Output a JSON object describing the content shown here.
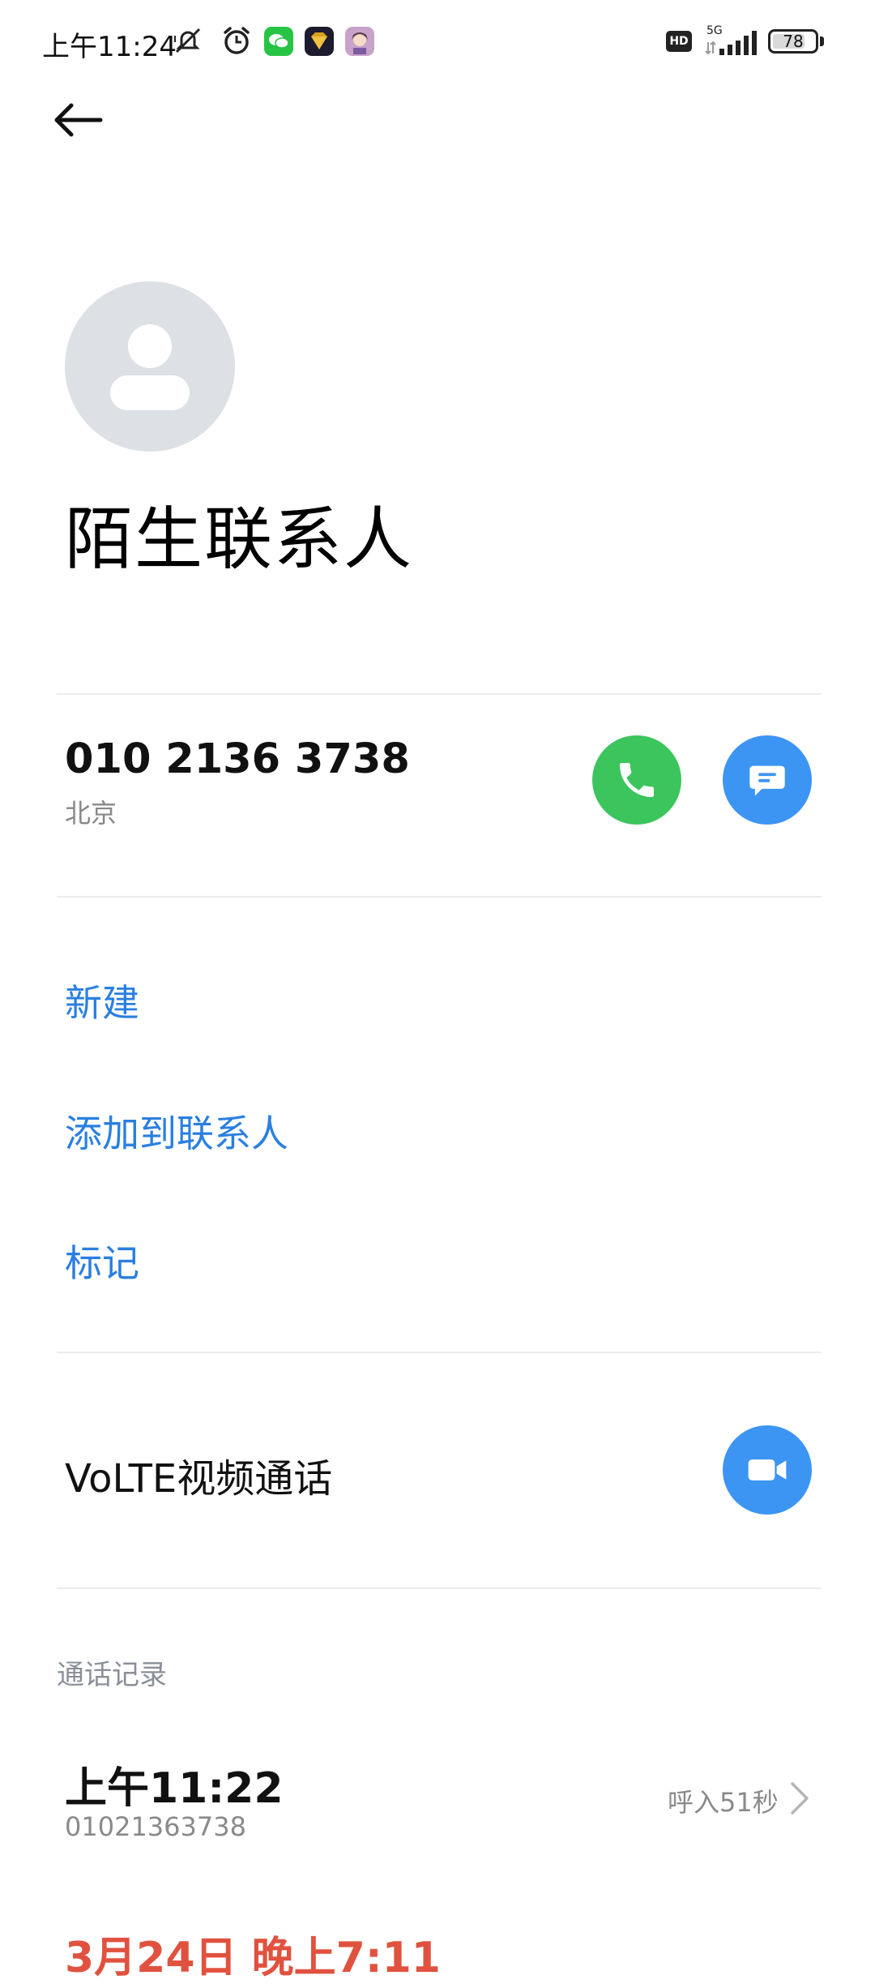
{
  "status_bar": {
    "time": "上午11:24",
    "battery": "78",
    "network": "5G",
    "hd": "HD",
    "battery_level": 0.78,
    "icons": [
      "mute-icon",
      "alarm-icon",
      "wechat-icon",
      "app-icon",
      "app-icon",
      "hd-icon",
      "signal-icon",
      "battery-icon"
    ]
  },
  "contact": {
    "name": "陌生联系人",
    "phone_number": "010 2136 3738",
    "location": "北京"
  },
  "actions": {
    "new": "新建",
    "add_to_contacts": "添加到联系人",
    "mark": "标记"
  },
  "volte": {
    "label": "VoLTE视频通话"
  },
  "call_log": {
    "title": "通话记录",
    "entries": [
      {
        "time": "上午11:22",
        "number": "01021363738",
        "detail": "呼入51秒"
      },
      {
        "time": "3月24日 晚上7:11"
      }
    ]
  },
  "colors": {
    "accent_blue": "#2a7fe0",
    "call_green": "#3cc55d",
    "button_blue": "#3d95f3",
    "missed_red": "#e0523f"
  }
}
